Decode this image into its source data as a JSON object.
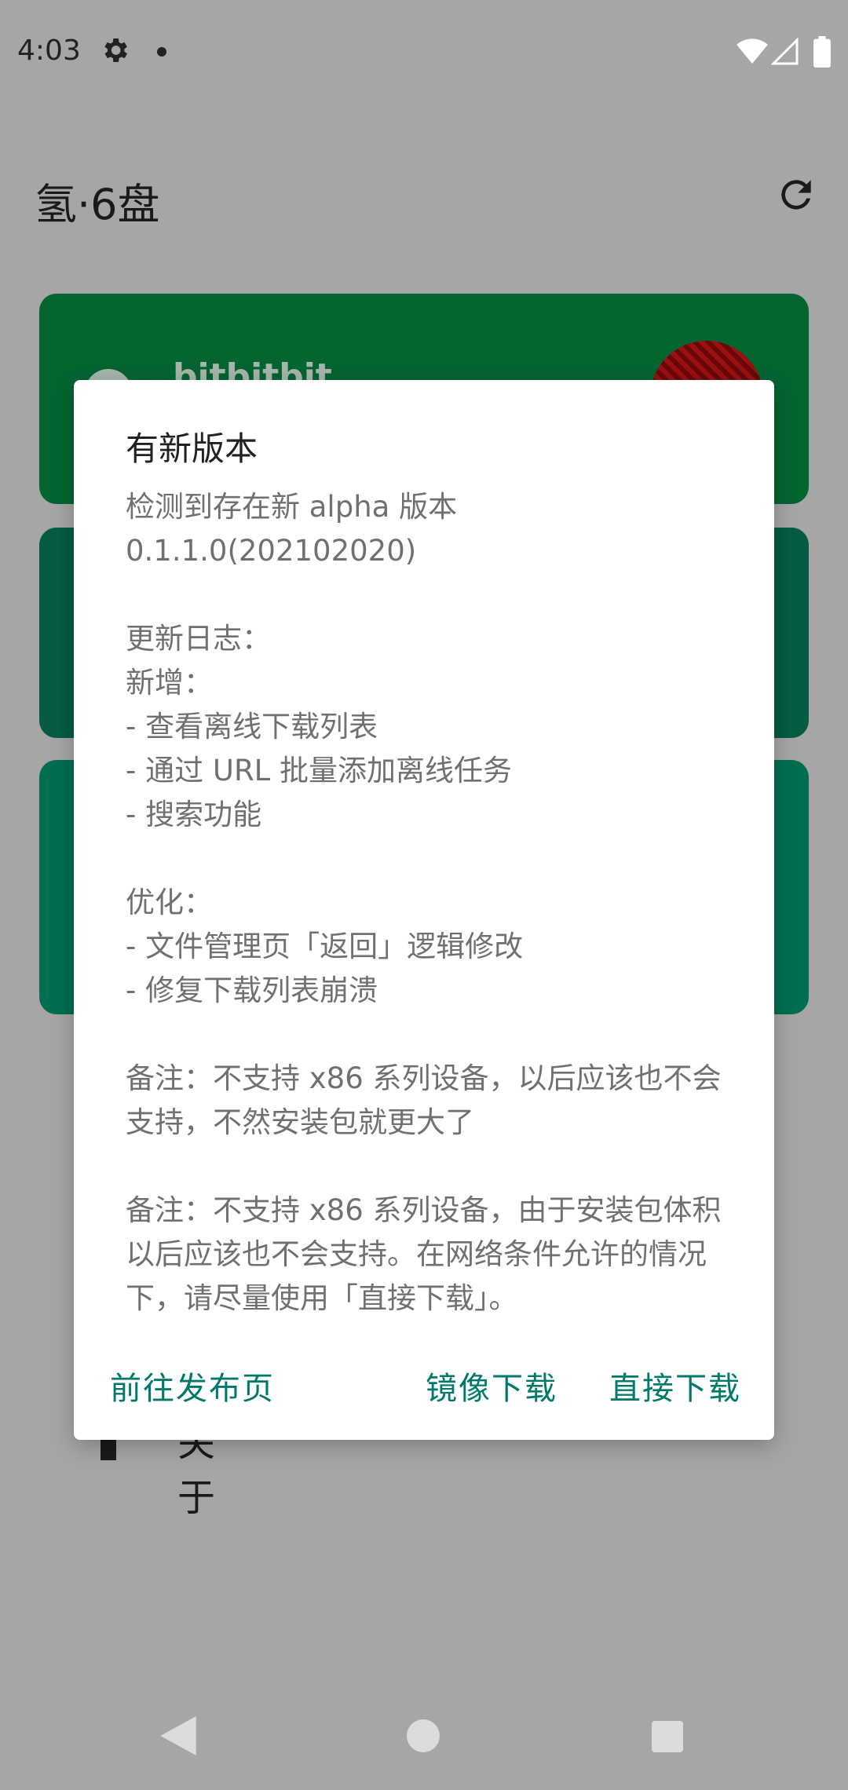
{
  "status_bar": {
    "time": "4:03",
    "icons": [
      "settings-icon",
      "notification-dot",
      "wifi-icon",
      "signal-icon",
      "battery-icon"
    ]
  },
  "app_bar": {
    "title": "氢·6盘",
    "action_icon": "refresh-icon"
  },
  "background": {
    "card_user": "bitbitbit",
    "menu_item_about": "关于"
  },
  "dialog": {
    "title": "有新版本",
    "message": "检测到存在新 alpha 版本\n0.1.1.0(202102020)\n\n更新日志：\n新增：\n- 查看离线下载列表\n- 通过 URL 批量添加离线任务\n- 搜索功能\n\n优化：\n- 文件管理页「返回」逻辑修改\n- 修复下载列表崩溃\n\n备注：不支持 x86 系列设备，以后应该也不会支持，不然安装包就更大了\n\n备注：不支持 x86 系列设备，由于安装包体积以后应该也不会支持。在网络条件允许的情况下，请尽量使用「直接下载」。",
    "buttons": {
      "release_page": "前往发布页",
      "mirror_download": "镜像下载",
      "direct_download": "直接下载"
    }
  },
  "colors": {
    "accent": "#00796b",
    "scrim": "#a6a6a6",
    "card1": "#046531",
    "card2": "#055c44",
    "card3": "#006e51"
  },
  "nav_bar": {
    "icons": [
      "back-icon",
      "home-icon",
      "recents-icon"
    ]
  }
}
